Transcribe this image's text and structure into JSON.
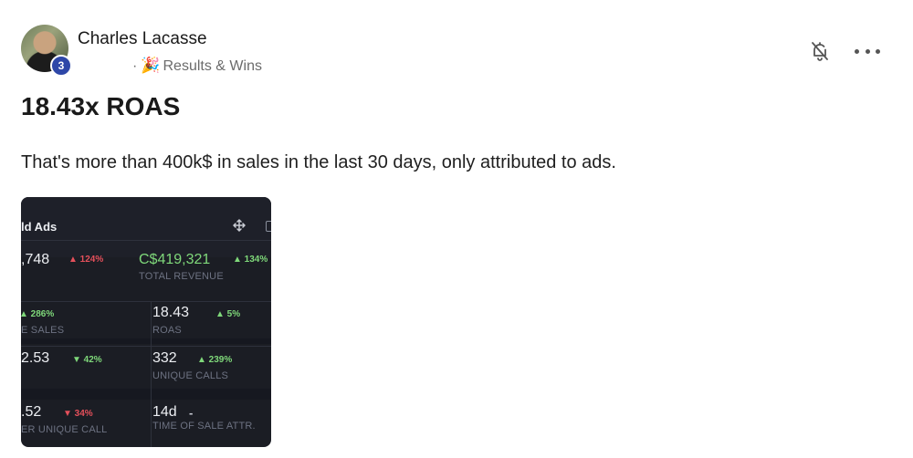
{
  "post": {
    "author": "Charles Lacasse",
    "level": "3",
    "separator": "·",
    "category_emoji": "🎉",
    "category": "Results & Wins",
    "title": "18.43x ROAS",
    "body": "That's more than 400k$ in sales in the last 30 days, only attributed to ads."
  },
  "header_icons": [
    "bell-off-icon",
    "more-icon"
  ],
  "screenshot": {
    "panel_title": "ld Ads",
    "metrics": [
      {
        "value": ",748",
        "change": "▲ 124%",
        "trend": "up-red",
        "label": ""
      },
      {
        "value": "C$419,321",
        "change": "▲ 134%",
        "trend": "up",
        "label": "TOTAL REVENUE"
      },
      {
        "value": "",
        "change": "▲ 286%",
        "trend": "up",
        "label": "E SALES"
      },
      {
        "value": "18.43",
        "change": "▲ 5%",
        "trend": "up",
        "label": "ROAS"
      },
      {
        "value": "2.53",
        "change": "▼ 42%",
        "trend": "down-green",
        "label": ""
      },
      {
        "value": "332",
        "change": "▲ 239%",
        "trend": "up",
        "label": "UNIQUE CALLS"
      },
      {
        "value": ".52",
        "change": "▼ 34%",
        "trend": "down",
        "label": "ER UNIQUE CALL"
      },
      {
        "value": "14d",
        "change": "-",
        "trend": "neutral",
        "label": "TIME OF SALE ATTR."
      }
    ]
  },
  "colors": {
    "accent": "#2e47a8",
    "positive": "#7fd87a",
    "negative": "#e5505b",
    "panel_bg": "#1b1d24"
  }
}
